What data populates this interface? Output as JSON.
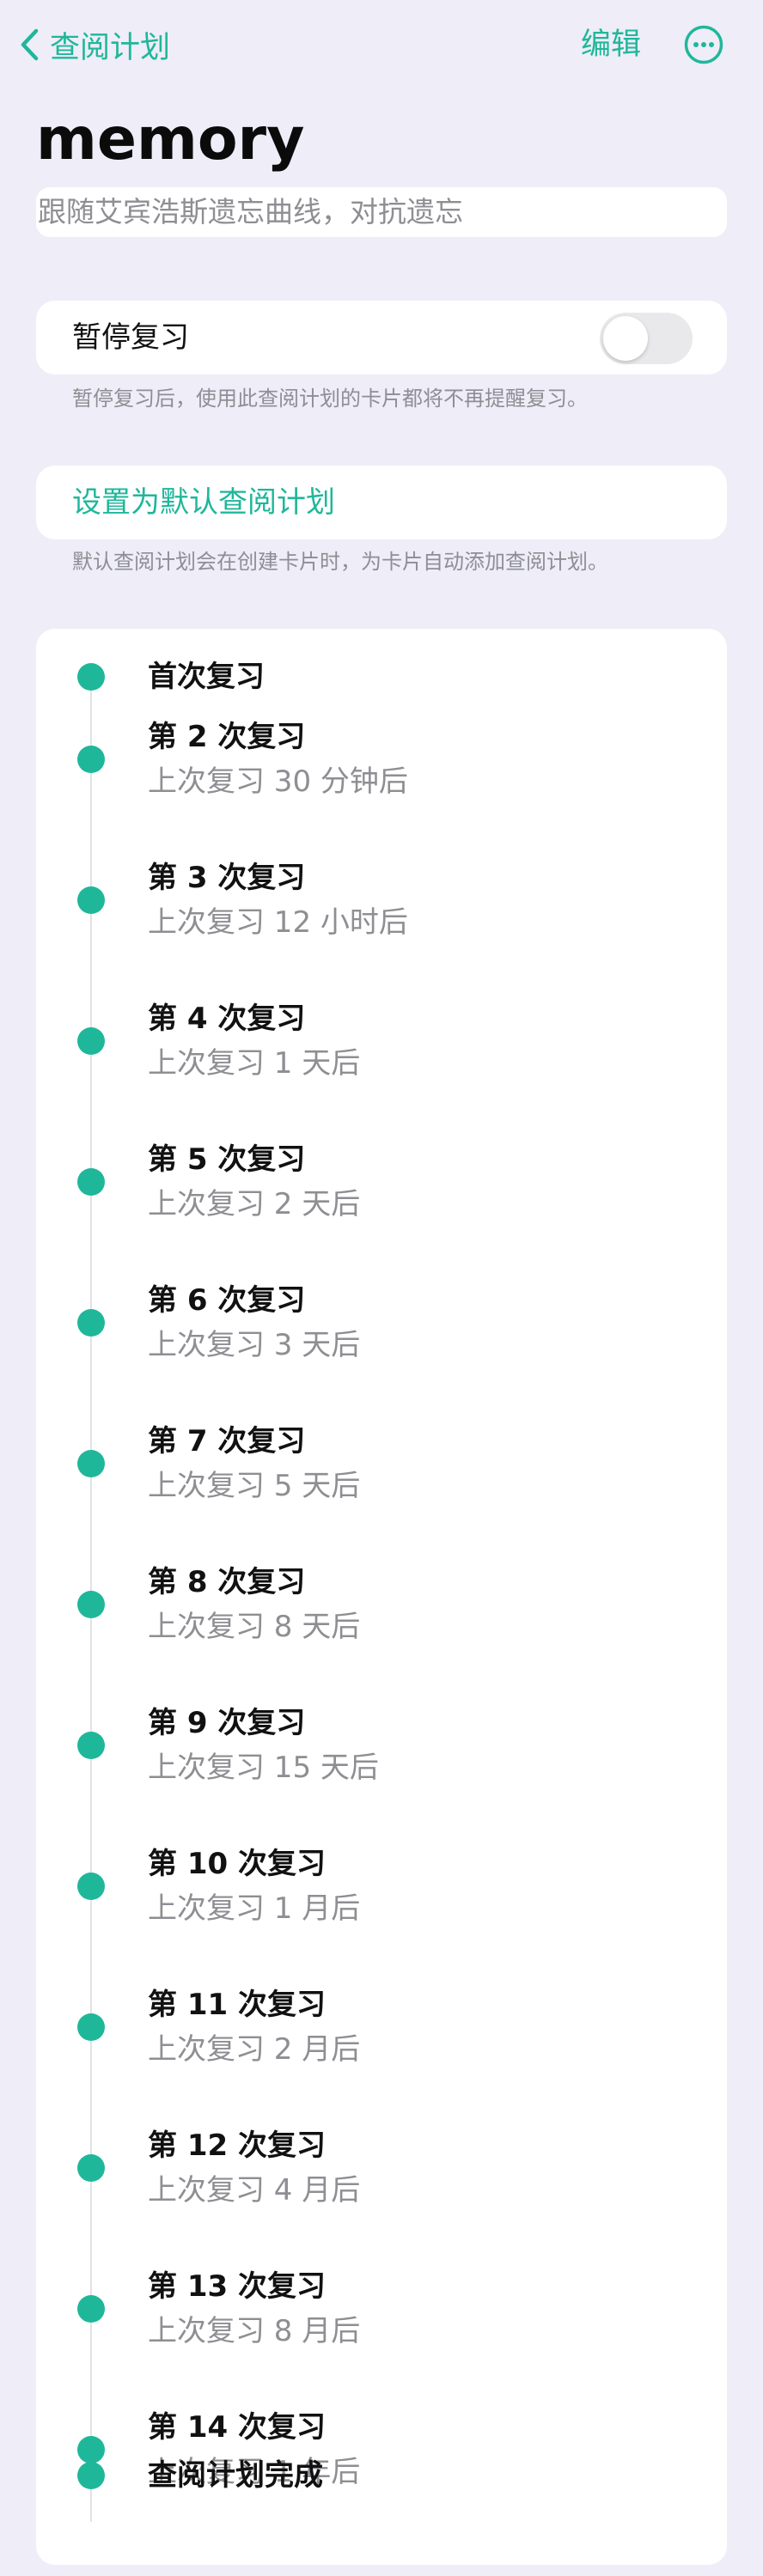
{
  "nav": {
    "back_label": "查阅计划",
    "edit_label": "编辑"
  },
  "plan": {
    "title": "memory",
    "description": "跟随艾宾浩斯遗忘曲线，对抗遗忘"
  },
  "pause": {
    "label": "暂停复习",
    "enabled": false,
    "hint": "暂停复习后，使用此查阅计划的卡片都将不再提醒复习。"
  },
  "default_plan": {
    "label": "设置为默认查阅计划",
    "hint": "默认查阅计划会在创建卡片时，为卡片自动添加查阅计划。"
  },
  "colors": {
    "accent": "#1fb79a",
    "background": "#eeedf8",
    "secondary_text": "#8e8e93"
  },
  "timeline": {
    "steps": [
      {
        "name": "首次复习",
        "interval": ""
      },
      {
        "name": "第 2 次复习",
        "interval": "上次复习 30 分钟后"
      },
      {
        "name": "第 3 次复习",
        "interval": "上次复习 12 小时后"
      },
      {
        "name": "第 4 次复习",
        "interval": "上次复习 1 天后"
      },
      {
        "name": "第 5 次复习",
        "interval": "上次复习 2 天后"
      },
      {
        "name": "第 6 次复习",
        "interval": "上次复习 3 天后"
      },
      {
        "name": "第 7 次复习",
        "interval": "上次复习 5 天后"
      },
      {
        "name": "第 8 次复习",
        "interval": "上次复习 8 天后"
      },
      {
        "name": "第 9 次复习",
        "interval": "上次复习 15 天后"
      },
      {
        "name": "第 10 次复习",
        "interval": "上次复习 1 月后"
      },
      {
        "name": "第 11 次复习",
        "interval": "上次复习 2 月后"
      },
      {
        "name": "第 12 次复习",
        "interval": "上次复习 4 月后"
      },
      {
        "name": "第 13 次复习",
        "interval": "上次复习 8 月后"
      },
      {
        "name": "第 14 次复习",
        "interval": "上次复习 1 年后"
      },
      {
        "name": "查阅计划完成",
        "interval": ""
      }
    ]
  }
}
